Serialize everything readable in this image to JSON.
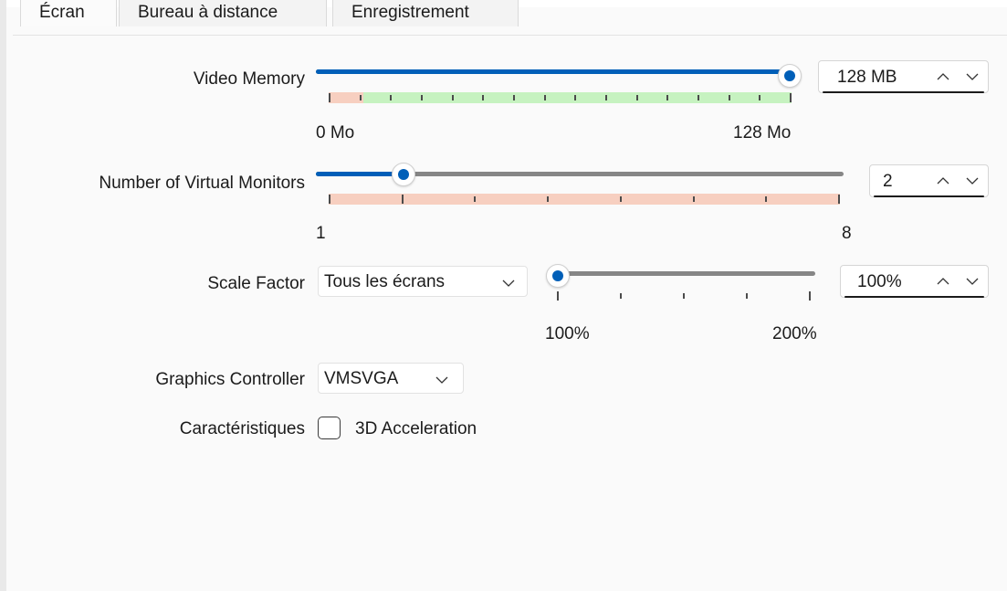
{
  "tabs": [
    {
      "label": "Écran",
      "active": true
    },
    {
      "label": "Bureau à distance",
      "active": false
    },
    {
      "label": "Enregistrement",
      "active": false
    }
  ],
  "video_memory": {
    "label": "Video Memory",
    "value_fraction": 1.0,
    "min_label": "0 Mo",
    "max_label": "128 Mo",
    "spin_value": "128 MB"
  },
  "monitors": {
    "label": "Number of Virtual Monitors",
    "value": 2,
    "min": 1,
    "max": 8,
    "min_label": "1",
    "max_label": "8",
    "spin_value": "2"
  },
  "scale": {
    "label": "Scale Factor",
    "screen_select": "Tous les écrans",
    "value_percent": 100,
    "min_label": "100%",
    "max_label": "200%",
    "spin_value": "100%"
  },
  "graphics": {
    "label": "Graphics Controller",
    "value": "VMSVGA"
  },
  "features": {
    "label": "Caractéristiques",
    "accel_label": "3D Acceleration",
    "accel_checked": false
  },
  "colors": {
    "accent": "#005fb8",
    "range_ok": "#c6f2c0",
    "range_warn": "#f7cfc0"
  }
}
